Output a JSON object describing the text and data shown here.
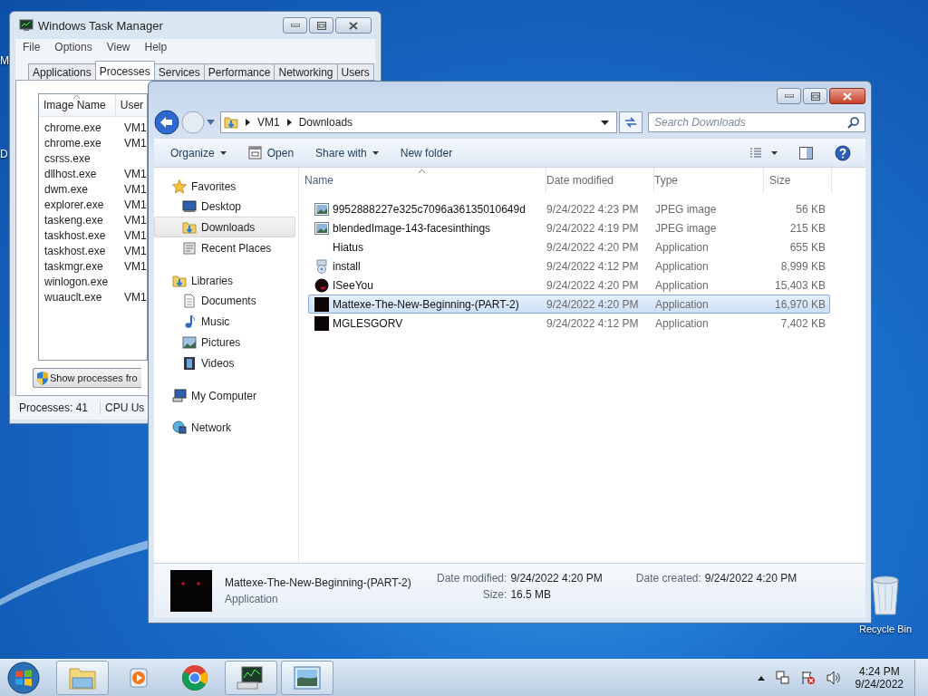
{
  "desktop": {
    "edge_labels": [
      "M",
      "D"
    ],
    "recycle_bin": "Recycle Bin"
  },
  "task_manager": {
    "title": "Windows Task Manager",
    "menu": [
      "File",
      "Options",
      "View",
      "Help"
    ],
    "tabs": [
      {
        "label": "Applications",
        "selected": false
      },
      {
        "label": "Processes",
        "selected": true
      },
      {
        "label": "Services",
        "selected": false
      },
      {
        "label": "Performance",
        "selected": false
      },
      {
        "label": "Networking",
        "selected": false
      },
      {
        "label": "Users",
        "selected": false
      }
    ],
    "columns": [
      {
        "label": "Image Name",
        "sorted": true
      },
      {
        "label": "User",
        "sorted": false
      }
    ],
    "rows": [
      {
        "image_name": "chrome.exe",
        "user": "VM1"
      },
      {
        "image_name": "chrome.exe",
        "user": "VM1"
      },
      {
        "image_name": "csrss.exe",
        "user": ""
      },
      {
        "image_name": "dllhost.exe",
        "user": "VM1"
      },
      {
        "image_name": "dwm.exe",
        "user": "VM1"
      },
      {
        "image_name": "explorer.exe",
        "user": "VM1"
      },
      {
        "image_name": "taskeng.exe",
        "user": "VM1"
      },
      {
        "image_name": "taskhost.exe",
        "user": "VM1"
      },
      {
        "image_name": "taskhost.exe",
        "user": "VM1"
      },
      {
        "image_name": "taskmgr.exe",
        "user": "VM1"
      },
      {
        "image_name": "winlogon.exe",
        "user": ""
      },
      {
        "image_name": "wuauclt.exe",
        "user": "VM1"
      }
    ],
    "show_button": "Show processes fro",
    "status": [
      "Processes: 41",
      "CPU Us"
    ]
  },
  "explorer": {
    "breadcrumb": [
      "VM1",
      "Downloads"
    ],
    "search": {
      "placeholder": "Search Downloads"
    },
    "toolbar": [
      {
        "label": "Organize",
        "kind": "menu"
      },
      {
        "label": "Open",
        "kind": "icon"
      },
      {
        "label": "Share with",
        "kind": "menu"
      },
      {
        "label": "New folder",
        "kind": "plain"
      }
    ],
    "nav": [
      {
        "label": "Favorites",
        "kind": "star",
        "children": [
          {
            "label": "Desktop",
            "kind": "desktop",
            "selected": false
          },
          {
            "label": "Downloads",
            "kind": "downloads",
            "selected": true
          },
          {
            "label": "Recent Places",
            "kind": "recent",
            "selected": false
          }
        ]
      },
      {
        "label": "Libraries",
        "kind": "libraries",
        "children": [
          {
            "label": "Documents",
            "kind": "document",
            "selected": false
          },
          {
            "label": "Music",
            "kind": "music",
            "selected": false
          },
          {
            "label": "Pictures",
            "kind": "pictures",
            "selected": false
          },
          {
            "label": "Videos",
            "kind": "videos",
            "selected": false
          }
        ]
      },
      {
        "label": "My Computer",
        "kind": "computer"
      },
      {
        "label": "Network",
        "kind": "network"
      }
    ],
    "columns": [
      {
        "label": "Name",
        "sorted": true
      },
      {
        "label": "Date modified",
        "sorted": false
      },
      {
        "label": "Type",
        "sorted": false
      },
      {
        "label": "Size",
        "sorted": false
      }
    ],
    "files": [
      {
        "name": "9952888227e325c7096a36135010649d",
        "date": "9/24/2022 4:23 PM",
        "type": "JPEG image",
        "size": "56 KB",
        "kind": "image",
        "selected": false
      },
      {
        "name": "blendedImage-143-facesinthings",
        "date": "9/24/2022 4:19 PM",
        "type": "JPEG image",
        "size": "215 KB",
        "kind": "image",
        "selected": false
      },
      {
        "name": "Hiatus",
        "date": "9/24/2022 4:20 PM",
        "type": "Application",
        "size": "655 KB",
        "kind": "none",
        "selected": false
      },
      {
        "name": "install",
        "date": "9/24/2022 4:12 PM",
        "type": "Application",
        "size": "8,999 KB",
        "kind": "installer",
        "selected": false
      },
      {
        "name": "ISeeYou",
        "date": "9/24/2022 4:20 PM",
        "type": "Application",
        "size": "15,403 KB",
        "kind": "round",
        "selected": false
      },
      {
        "name": "Mattexe-The-New-Beginning-(PART-2)",
        "date": "9/24/2022 4:20 PM",
        "type": "Application",
        "size": "16,970 KB",
        "kind": "dark",
        "selected": true
      },
      {
        "name": "MGLESGORV",
        "date": "9/24/2022 4:12 PM",
        "type": "Application",
        "size": "7,402 KB",
        "kind": "dark",
        "selected": false
      }
    ],
    "details": {
      "name": "Mattexe-The-New-Beginning-(PART-2)",
      "type": "Application",
      "fields": [
        {
          "label": "Date modified:",
          "value": "9/24/2022 4:20 PM"
        },
        {
          "label": "Size:",
          "value": "16.5 MB"
        },
        {
          "label": "Date created:",
          "value": "9/24/2022 4:20 PM"
        }
      ]
    }
  },
  "taskbar": {
    "buttons": [
      {
        "kind": "explorer",
        "running": true
      },
      {
        "kind": "media",
        "running": false
      },
      {
        "kind": "chrome",
        "running": false
      },
      {
        "kind": "taskmgr",
        "running": true
      },
      {
        "kind": "photos",
        "running": true
      }
    ],
    "clock": {
      "time": "4:24 PM",
      "date": "9/24/2022"
    }
  }
}
